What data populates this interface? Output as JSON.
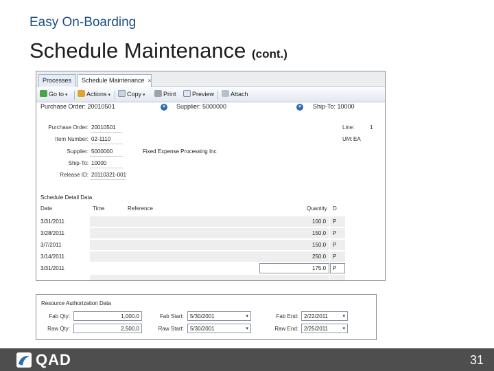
{
  "slide": {
    "kicker": "Easy On-Boarding",
    "title": "Schedule Maintenance",
    "title_suffix": "(cont.)",
    "page_number": "31",
    "logo_text": "QAD"
  },
  "window": {
    "tabs": [
      {
        "label": "Processes"
      },
      {
        "label": "Schedule Maintenance",
        "close": "×"
      }
    ],
    "toolbar": [
      {
        "label": "Go to",
        "icon": "go-to-icon"
      },
      {
        "label": "Actions",
        "icon": "actions-icon"
      },
      {
        "label": "Copy",
        "icon": "copy-icon"
      },
      {
        "label": "Print",
        "icon": "print-icon"
      },
      {
        "label": "Preview",
        "icon": "preview-icon"
      },
      {
        "label": "Attach",
        "icon": "attach-icon"
      }
    ],
    "dropdown_glyph": "▾",
    "header_fields": {
      "purchase_order": "Purchase Order: 20010501",
      "supplier": "Supplier: 5000000",
      "ship_to": "Ship-To: 10000"
    },
    "details": {
      "purchase_order_label": "Purchase Order:",
      "purchase_order_value": "20010501",
      "item_number_label": "Item Number:",
      "item_number_value": "02-1110",
      "supplier_label": "Supplier:",
      "supplier_value": "5000000",
      "supplier_name": "Fixed Expense Processing Inc",
      "ship_to_label": "Ship-To:",
      "ship_to_value": "10000",
      "release_id_label": "Release ID:",
      "release_id_value": "20110321-001",
      "line_label": "Line:",
      "line_value": "1",
      "um_label": "UM:",
      "um_value": "EA"
    },
    "grid": {
      "title": "Schedule Detail Data",
      "columns": [
        "Date",
        "Time",
        "Reference",
        "Quantity",
        "D"
      ],
      "rows": [
        {
          "date": "3/31/2011",
          "quantity": "100.0",
          "d": "P"
        },
        {
          "date": "3/28/2011",
          "quantity": "150.0",
          "d": "P"
        },
        {
          "date": "3/7/2011",
          "quantity": "150.0",
          "d": "P"
        },
        {
          "date": "3/14/2011",
          "quantity": "250.0",
          "d": "P"
        },
        {
          "date": "3/31/2011",
          "quantity": "175.0",
          "d": "P"
        }
      ]
    }
  },
  "resource": {
    "title": "Resource Authorization Data",
    "fab_qty_label": "Fab Qty:",
    "fab_qty_value": "1,000.0",
    "raw_qty_label": "Raw Qty:",
    "raw_qty_value": "2,500.0",
    "fab_start_label": "Fab Start:",
    "fab_start_value": "5/30/2001",
    "raw_start_label": "Raw Start:",
    "raw_start_value": "5/30/2001",
    "fab_end_label": "Fab End:",
    "fab_end_value": "2/22/2011",
    "raw_end_label": "Raw End:",
    "raw_end_value": "2/25/2011"
  },
  "colors": {
    "kicker": "#1a4f7f",
    "footer": "#4e4e4e",
    "accent": "#2e6bb6"
  }
}
